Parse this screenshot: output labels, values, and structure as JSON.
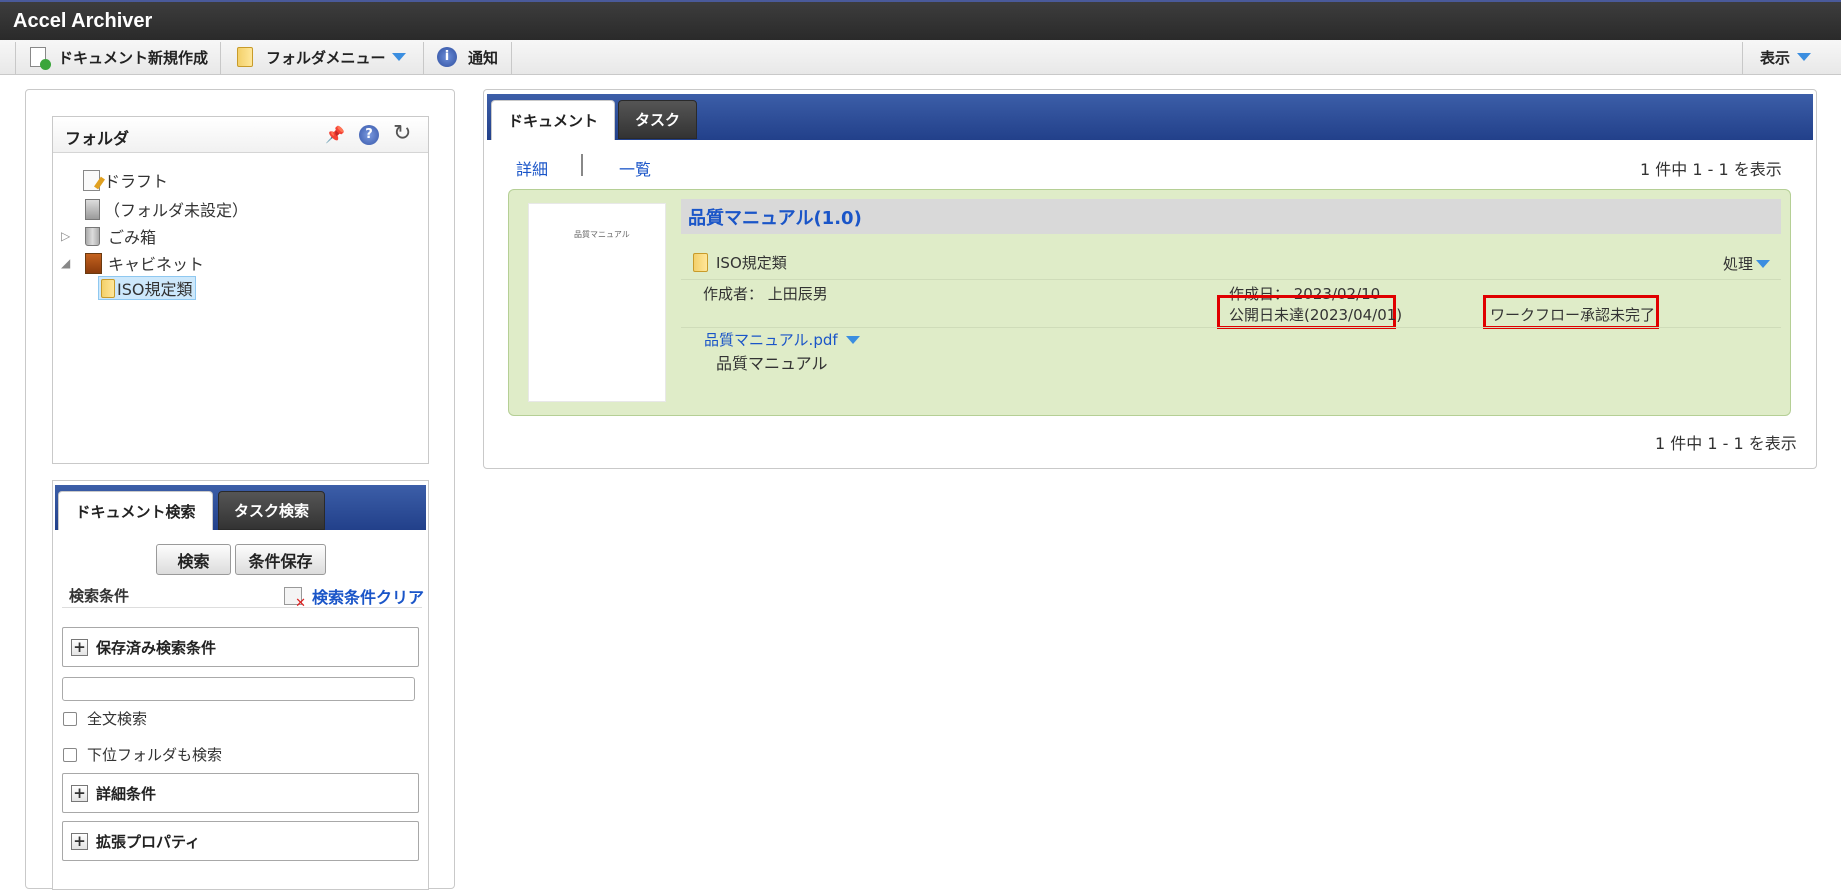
{
  "app": {
    "title": "Accel Archiver"
  },
  "toolbar": {
    "new_document": "ドキュメント新規作成",
    "folder_menu": "フォルダメニュー",
    "notification": "通知",
    "display": "表示"
  },
  "folder_panel": {
    "title": "フォルダ",
    "tree": [
      {
        "label": "ドラフト",
        "icon": "draft-icon"
      },
      {
        "label": "（フォルダ未設定）",
        "icon": "unset-folder-icon"
      },
      {
        "label": "ごみ箱",
        "icon": "trash-icon"
      },
      {
        "label": "キャビネット",
        "icon": "cabinet-icon"
      },
      {
        "label": "ISO規定類",
        "icon": "folder-icon",
        "selected": true
      }
    ]
  },
  "search_panel": {
    "tabs": [
      {
        "label": "ドキュメント検索",
        "active": true
      },
      {
        "label": "タスク検索",
        "active": false
      }
    ],
    "search_button": "検索",
    "save_condition_button": "条件保存",
    "conditions_label": "検索条件",
    "clear_conditions": "検索条件クリア",
    "saved_conditions": "保存済み検索条件",
    "saved_conditions_value": "",
    "fulltext_search": "全文検索",
    "include_subfolders": "下位フォルダも検索",
    "detailed_conditions": "詳細条件",
    "extended_properties": "拡張プロパティ"
  },
  "main": {
    "tabs": [
      {
        "label": "ドキュメント",
        "active": true
      },
      {
        "label": "タスク",
        "active": false
      }
    ],
    "view_detail": "詳細",
    "view_list": "一覧",
    "count_top": "1 件中 1 - 1 を表示",
    "count_bottom": "1 件中 1 - 1 を表示",
    "document": {
      "thumbnail_text": "品質マニュアル",
      "title": "品質マニュアル(1.0)",
      "folder": "ISO規定類",
      "action": "処理",
      "author": "作成者：  上田辰男",
      "created": "作成日：  2023/02/10",
      "publish_status": "公開日未達(2023/04/01)",
      "workflow_status": "ワークフロー承認未完了",
      "file_name": "品質マニュアル.pdf",
      "file_description": "品質マニュアル"
    }
  },
  "colors": {
    "tab_bar": "#2b4a94",
    "card_bg": "#dfecc8",
    "link": "#1a55c8",
    "highlight": "#e00000"
  }
}
